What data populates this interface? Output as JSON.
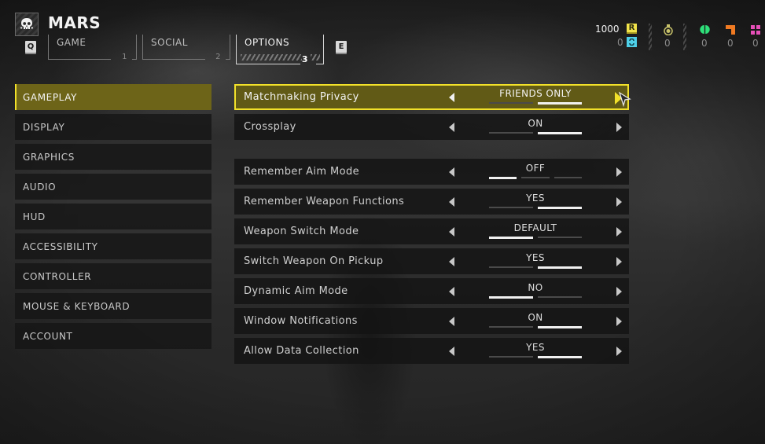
{
  "header": {
    "player_name": "MARS",
    "player_icon": "skull-icon",
    "prev_key": "Q",
    "next_key": "E",
    "tabs": [
      {
        "label": "GAME",
        "number": "1",
        "active": false
      },
      {
        "label": "SOCIAL",
        "number": "2",
        "active": false
      },
      {
        "label": "OPTIONS",
        "number": "3",
        "active": true
      }
    ]
  },
  "currencies": {
    "requisition": {
      "value": "1000",
      "badge": "R",
      "color": "#f2e44a"
    },
    "super_credits": {
      "value": "0",
      "icon": "super-credits-icon",
      "color": "#4fd0e8"
    },
    "medals": {
      "value": "0",
      "icon": "medal-icon",
      "color": "#c8c26a"
    },
    "common_samples": {
      "value": "0",
      "icon": "common-sample-icon",
      "color": "#2ee07a"
    },
    "rare_samples": {
      "value": "0",
      "icon": "rare-sample-icon",
      "color": "#f07a22"
    },
    "super_samples": {
      "value": "0",
      "icon": "super-sample-icon",
      "color": "#e64fb8"
    }
  },
  "sidebar": {
    "items": [
      {
        "label": "GAMEPLAY",
        "active": true
      },
      {
        "label": "DISPLAY",
        "active": false
      },
      {
        "label": "GRAPHICS",
        "active": false
      },
      {
        "label": "AUDIO",
        "active": false
      },
      {
        "label": "HUD",
        "active": false
      },
      {
        "label": "ACCESSIBILITY",
        "active": false
      },
      {
        "label": "CONTROLLER",
        "active": false
      },
      {
        "label": "MOUSE & KEYBOARD",
        "active": false
      },
      {
        "label": "ACCOUNT",
        "active": false
      }
    ]
  },
  "settings": [
    {
      "label": "Matchmaking Privacy",
      "value": "FRIENDS ONLY",
      "options_count": 2,
      "selected_index": 1,
      "active": true
    },
    {
      "label": "Crossplay",
      "value": "ON",
      "options_count": 2,
      "selected_index": 1,
      "active": false
    },
    {
      "label": "Remember Aim Mode",
      "value": "OFF",
      "options_count": 3,
      "selected_index": 0,
      "active": false
    },
    {
      "label": "Remember Weapon Functions",
      "value": "YES",
      "options_count": 2,
      "selected_index": 1,
      "active": false
    },
    {
      "label": "Weapon Switch Mode",
      "value": "DEFAULT",
      "options_count": 2,
      "selected_index": 0,
      "active": false
    },
    {
      "label": "Switch Weapon On Pickup",
      "value": "YES",
      "options_count": 2,
      "selected_index": 1,
      "active": false
    },
    {
      "label": "Dynamic Aim Mode",
      "value": "NO",
      "options_count": 2,
      "selected_index": 0,
      "active": false
    },
    {
      "label": "Window Notifications",
      "value": "ON",
      "options_count": 2,
      "selected_index": 1,
      "active": false
    },
    {
      "label": "Allow Data Collection",
      "value": "YES",
      "options_count": 2,
      "selected_index": 1,
      "active": false
    }
  ],
  "colors": {
    "accent": "#f2e12a",
    "active_bg": "#6d6418"
  }
}
